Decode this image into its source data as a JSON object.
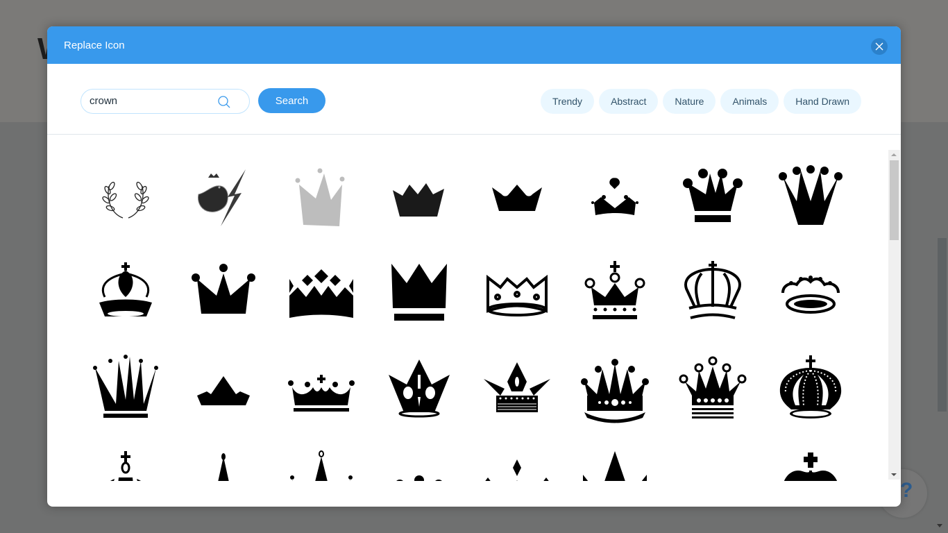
{
  "background": {
    "heading_fragment": "W",
    "help_label": "?"
  },
  "modal": {
    "title": "Replace Icon",
    "close_icon": "close-icon"
  },
  "search": {
    "value": "crown",
    "placeholder": "",
    "icon": "search-icon",
    "button_label": "Search"
  },
  "categories": [
    {
      "label": "Trendy"
    },
    {
      "label": "Abstract"
    },
    {
      "label": "Nature"
    },
    {
      "label": "Animals"
    },
    {
      "label": "Hand Drawn"
    }
  ],
  "colors": {
    "accent": "#3899ec",
    "close_bg": "#2b81cb",
    "chip_bg": "#eaf7ff",
    "chip_text": "#32536a"
  },
  "icons": [
    {
      "name": "laurel-wreath-icon"
    },
    {
      "name": "crowned-bird-lightning-icon"
    },
    {
      "name": "hand-drawn-gray-crown-icon"
    },
    {
      "name": "brush-crown-icon"
    },
    {
      "name": "notched-crown-icon"
    },
    {
      "name": "heart-crown-icon"
    },
    {
      "name": "queen-crown-base-icon"
    },
    {
      "name": "five-ball-crown-icon"
    },
    {
      "name": "orb-cross-crown-icon"
    },
    {
      "name": "three-ball-crown-icon"
    },
    {
      "name": "diamond-crown-icon"
    },
    {
      "name": "spiked-crown-base-icon"
    },
    {
      "name": "outline-diamond-crown-icon"
    },
    {
      "name": "cross-dotted-crown-icon"
    },
    {
      "name": "outline-arched-crown-icon"
    },
    {
      "name": "pearl-tiara-icon"
    },
    {
      "name": "tall-spike-crown-icon"
    },
    {
      "name": "small-peak-crown-icon"
    },
    {
      "name": "cross-pearl-crown-icon"
    },
    {
      "name": "ornate-spike-crown-icon"
    },
    {
      "name": "winged-crown-icon"
    },
    {
      "name": "jeweled-ball-crown-icon"
    },
    {
      "name": "ring-ball-crown-icon"
    },
    {
      "name": "imperial-pearl-crown-icon"
    },
    {
      "name": "orb-arch-crown-icon"
    },
    {
      "name": "single-spike-crown-icon"
    },
    {
      "name": "double-spike-crown-icon"
    },
    {
      "name": "small-ball-crown-icon"
    },
    {
      "name": "diamond-tip-crown-icon"
    },
    {
      "name": "solid-block-crown-icon"
    },
    {
      "name": "lattice-crown-icon"
    },
    {
      "name": "royal-cross-crown-icon"
    }
  ]
}
